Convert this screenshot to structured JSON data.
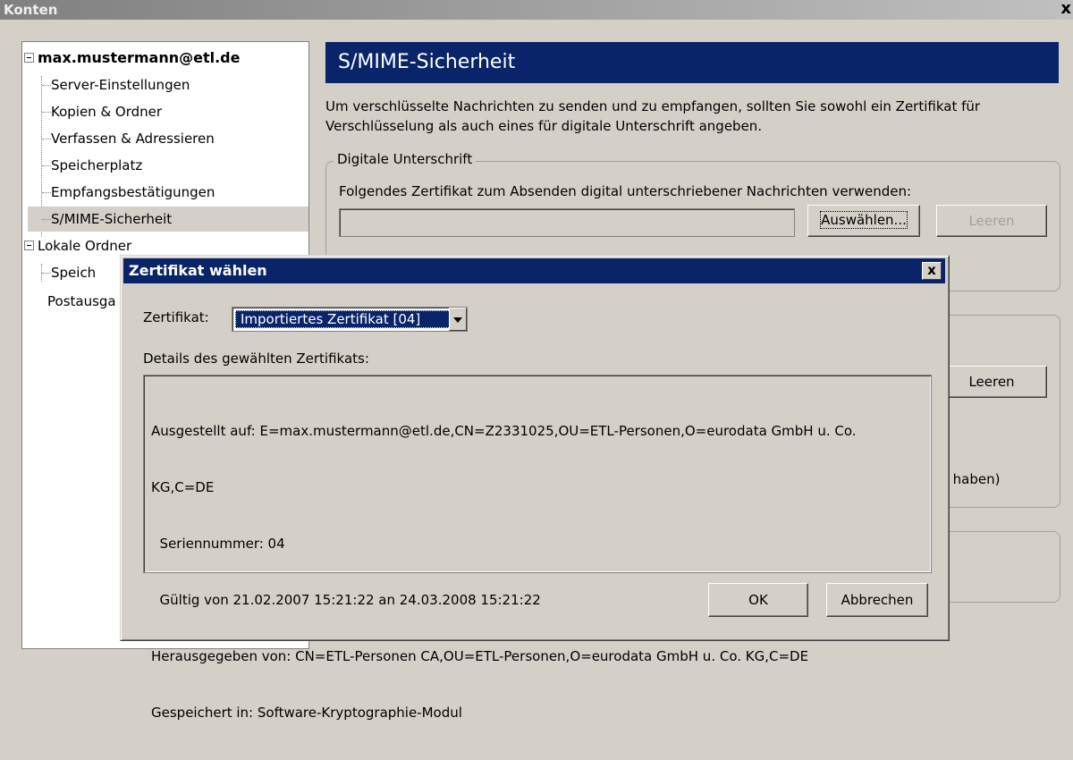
{
  "window": {
    "title": "Konten",
    "close": "x"
  },
  "tree": {
    "account": "max.mustermann@etl.de",
    "items": [
      "Server-Einstellungen",
      "Kopien & Ordner",
      "Verfassen & Adressieren",
      "Speicherplatz",
      "Empfangsbestätigungen",
      "S/MIME-Sicherheit"
    ],
    "local_folders": "Lokale Ordner",
    "local_sub": "Speich",
    "outgoing": "Postausga"
  },
  "panel": {
    "title": "S/MIME-Sicherheit",
    "description": "Um verschlüsselte Nachrichten zu senden und zu empfangen, sollten Sie sowohl ein Zertifikat für Verschlüsselung als auch eines für digitale Unterschrift angeben.",
    "signature_group": "Digitale Unterschrift",
    "signature_label": "Folgendes Zertifikat zum Absenden digital unterschriebener Nachrichten verwenden:",
    "select_button": "Auswählen...",
    "clear_button": "Leeren",
    "clear_button_2": "Leeren",
    "partial_text": "t haben)"
  },
  "dialog": {
    "title": "Zertifikat wählen",
    "close": "x",
    "cert_label": "Zertifikat:",
    "cert_value": "Importiertes Zertifikat [04]",
    "details_label": "Details des gewählten Zertifikats:",
    "details_lines": [
      "Ausgestellt auf: E=max.mustermann@etl.de,CN=Z2331025,OU=ETL-Personen,O=eurodata GmbH u. Co.",
      "KG,C=DE",
      "  Seriennummer: 04",
      "  Gültig von 21.02.2007 15:21:22 an 24.03.2008 15:21:22",
      "Herausgegeben von: CN=ETL-Personen CA,OU=ETL-Personen,O=eurodata GmbH u. Co. KG,C=DE",
      "Gespeichert in: Software-Kryptographie-Modul"
    ],
    "ok_button": "OK",
    "cancel_button": "Abbrechen"
  }
}
